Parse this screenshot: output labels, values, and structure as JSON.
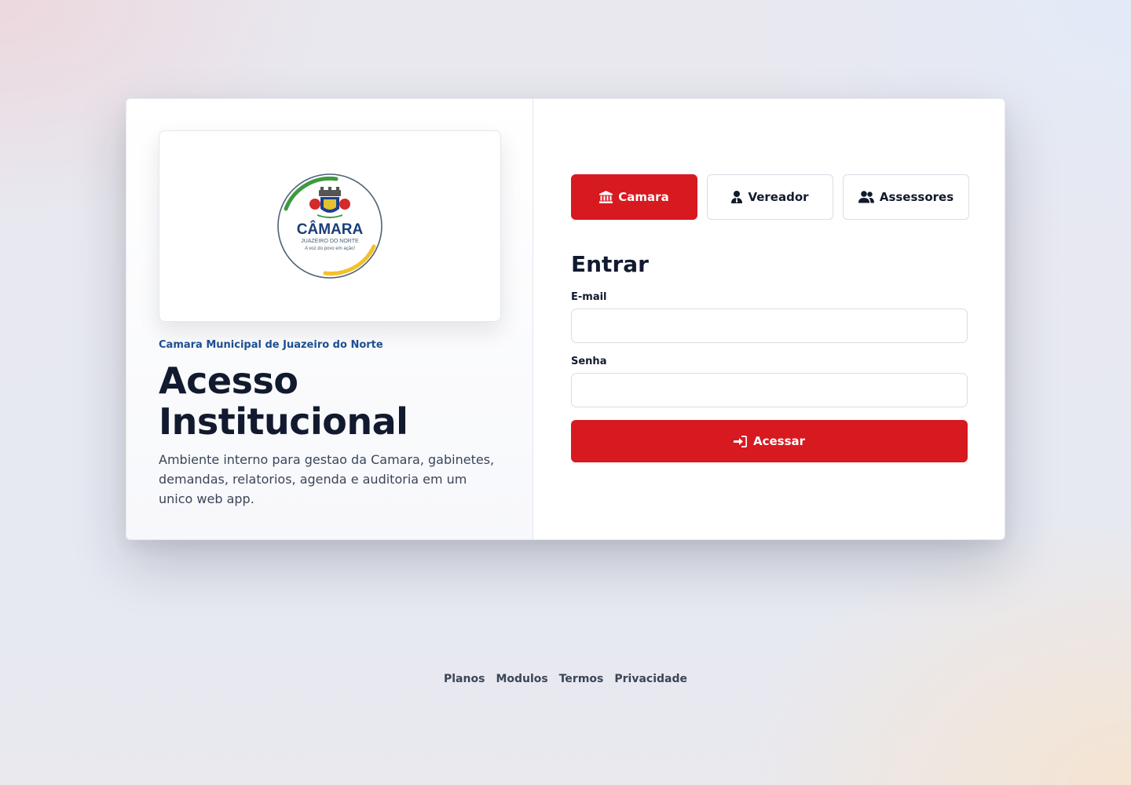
{
  "left": {
    "logo": {
      "text_main": "CÂMARA",
      "text_sub": "JUAZEIRO DO NORTE",
      "tagline": "A voz do povo em ação!"
    },
    "org_name": "Camara Municipal de Juazeiro do Norte",
    "title_line1": "Acesso",
    "title_line2": "Institucional",
    "description": "Ambiente interno para gestao da Camara, gabinetes, demandas, relatorios, agenda e auditoria em um unico web app."
  },
  "tabs": [
    {
      "label": "Camara",
      "icon": "institution-icon",
      "active": true
    },
    {
      "label": "Vereador",
      "icon": "user-tie-icon",
      "active": false
    },
    {
      "label": "Assessores",
      "icon": "users-icon",
      "active": false
    }
  ],
  "form": {
    "title": "Entrar",
    "email_label": "E-mail",
    "email_value": "",
    "password_label": "Senha",
    "password_value": "",
    "submit_label": "Acessar",
    "submit_icon": "sign-in-icon"
  },
  "footer": {
    "links": [
      "Planos",
      "Modulos",
      "Termos",
      "Privacidade"
    ]
  },
  "colors": {
    "accent": "#d71920",
    "org_text": "#1d4f91",
    "heading": "#111a2e"
  }
}
